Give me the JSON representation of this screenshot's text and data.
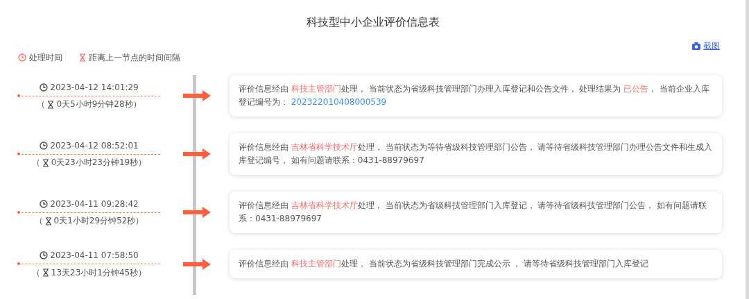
{
  "title": "科技型中小企业评价信息表",
  "screenshot_link": {
    "label": "截图"
  },
  "legend": [
    {
      "kind": "clock",
      "label": "处理时间"
    },
    {
      "kind": "hourglass",
      "label": "距离上一节点的时间间隔"
    }
  ],
  "records": [
    {
      "time": "2023-04-12 14:01:29",
      "interval_prefix": "（",
      "interval": "0天5小时9分钟28秒）",
      "message": [
        {
          "kind": "plain",
          "text": "评价信息经由 "
        },
        {
          "kind": "highlight",
          "text": "科技主管部门"
        },
        {
          "kind": "plain",
          "text": "处理， 当前状态为省级科技管理部门办理入库登记和公告文件， 处理结果为 "
        },
        {
          "kind": "highlight",
          "text": "已公告"
        },
        {
          "kind": "plain",
          "text": "， 当前企业入库登记编号为： "
        },
        {
          "kind": "number",
          "text": "202322010408000539"
        }
      ]
    },
    {
      "time": "2023-04-12 08:52:01",
      "interval_prefix": "（",
      "interval": "0天23小时23分钟19秒）",
      "message": [
        {
          "kind": "plain",
          "text": "评价信息经由 "
        },
        {
          "kind": "highlight",
          "text": "吉林省科学技术厅"
        },
        {
          "kind": "plain",
          "text": "处理， 当前状态为等待省级科技管理部门公告， 请等待省级科技管理部门办理公告文件和生成入库登记编号， 如有问题请联系：0431-88979697"
        }
      ]
    },
    {
      "time": "2023-04-11 09:28:42",
      "interval_prefix": "（",
      "interval": "0天1小时29分钟52秒）",
      "message": [
        {
          "kind": "plain",
          "text": "评价信息经由 "
        },
        {
          "kind": "highlight",
          "text": "吉林省科学技术厅"
        },
        {
          "kind": "plain",
          "text": "处理， 当前状态为省级科技管理部门入库登记， 请等待省级科技管理部门公告， 如有问题请联系：0431-88979697"
        }
      ]
    },
    {
      "time": "2023-04-11 07:58:50",
      "interval_prefix": "（",
      "interval": "13天23小时1分钟45秒）",
      "message": [
        {
          "kind": "plain",
          "text": "评价信息经由 "
        },
        {
          "kind": "highlight",
          "text": "科技主管部门"
        },
        {
          "kind": "plain",
          "text": "处理， 当前状态为省级科技管理部门完成公示 ， 请等待省级科技管理部门入库登记"
        }
      ]
    }
  ]
}
